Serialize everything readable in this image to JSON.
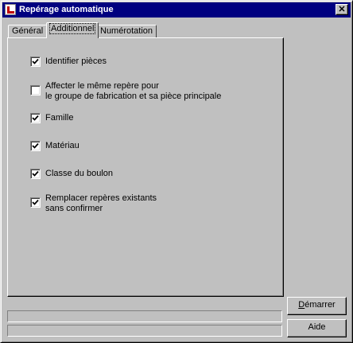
{
  "window": {
    "title": "Repérage automatique",
    "close_glyph": "✕"
  },
  "tabs": [
    {
      "label": "Général",
      "active": false
    },
    {
      "label": "Additionnel",
      "active": true
    },
    {
      "label": "Numérotation",
      "active": false
    }
  ],
  "options": [
    {
      "lines": [
        "Identifier pièces"
      ],
      "checked": true
    },
    {
      "lines": [
        "Affecter le même repère pour",
        "le groupe de fabrication et sa pièce principale"
      ],
      "checked": false
    },
    {
      "lines": [
        "Famille"
      ],
      "checked": true
    },
    {
      "lines": [
        "Matériau"
      ],
      "checked": true
    },
    {
      "lines": [
        "Classe du boulon"
      ],
      "checked": true
    },
    {
      "lines": [
        "Remplacer repères existants",
        "sans confirmer"
      ],
      "checked": true
    }
  ],
  "status_bar": {
    "line1": "",
    "line2": ""
  },
  "buttons": {
    "start": {
      "first": "D",
      "rest": "émarrer"
    },
    "help": {
      "label": "Aide"
    }
  },
  "colors": {
    "titlebar": "#000080",
    "face": "#c0c0c0"
  }
}
